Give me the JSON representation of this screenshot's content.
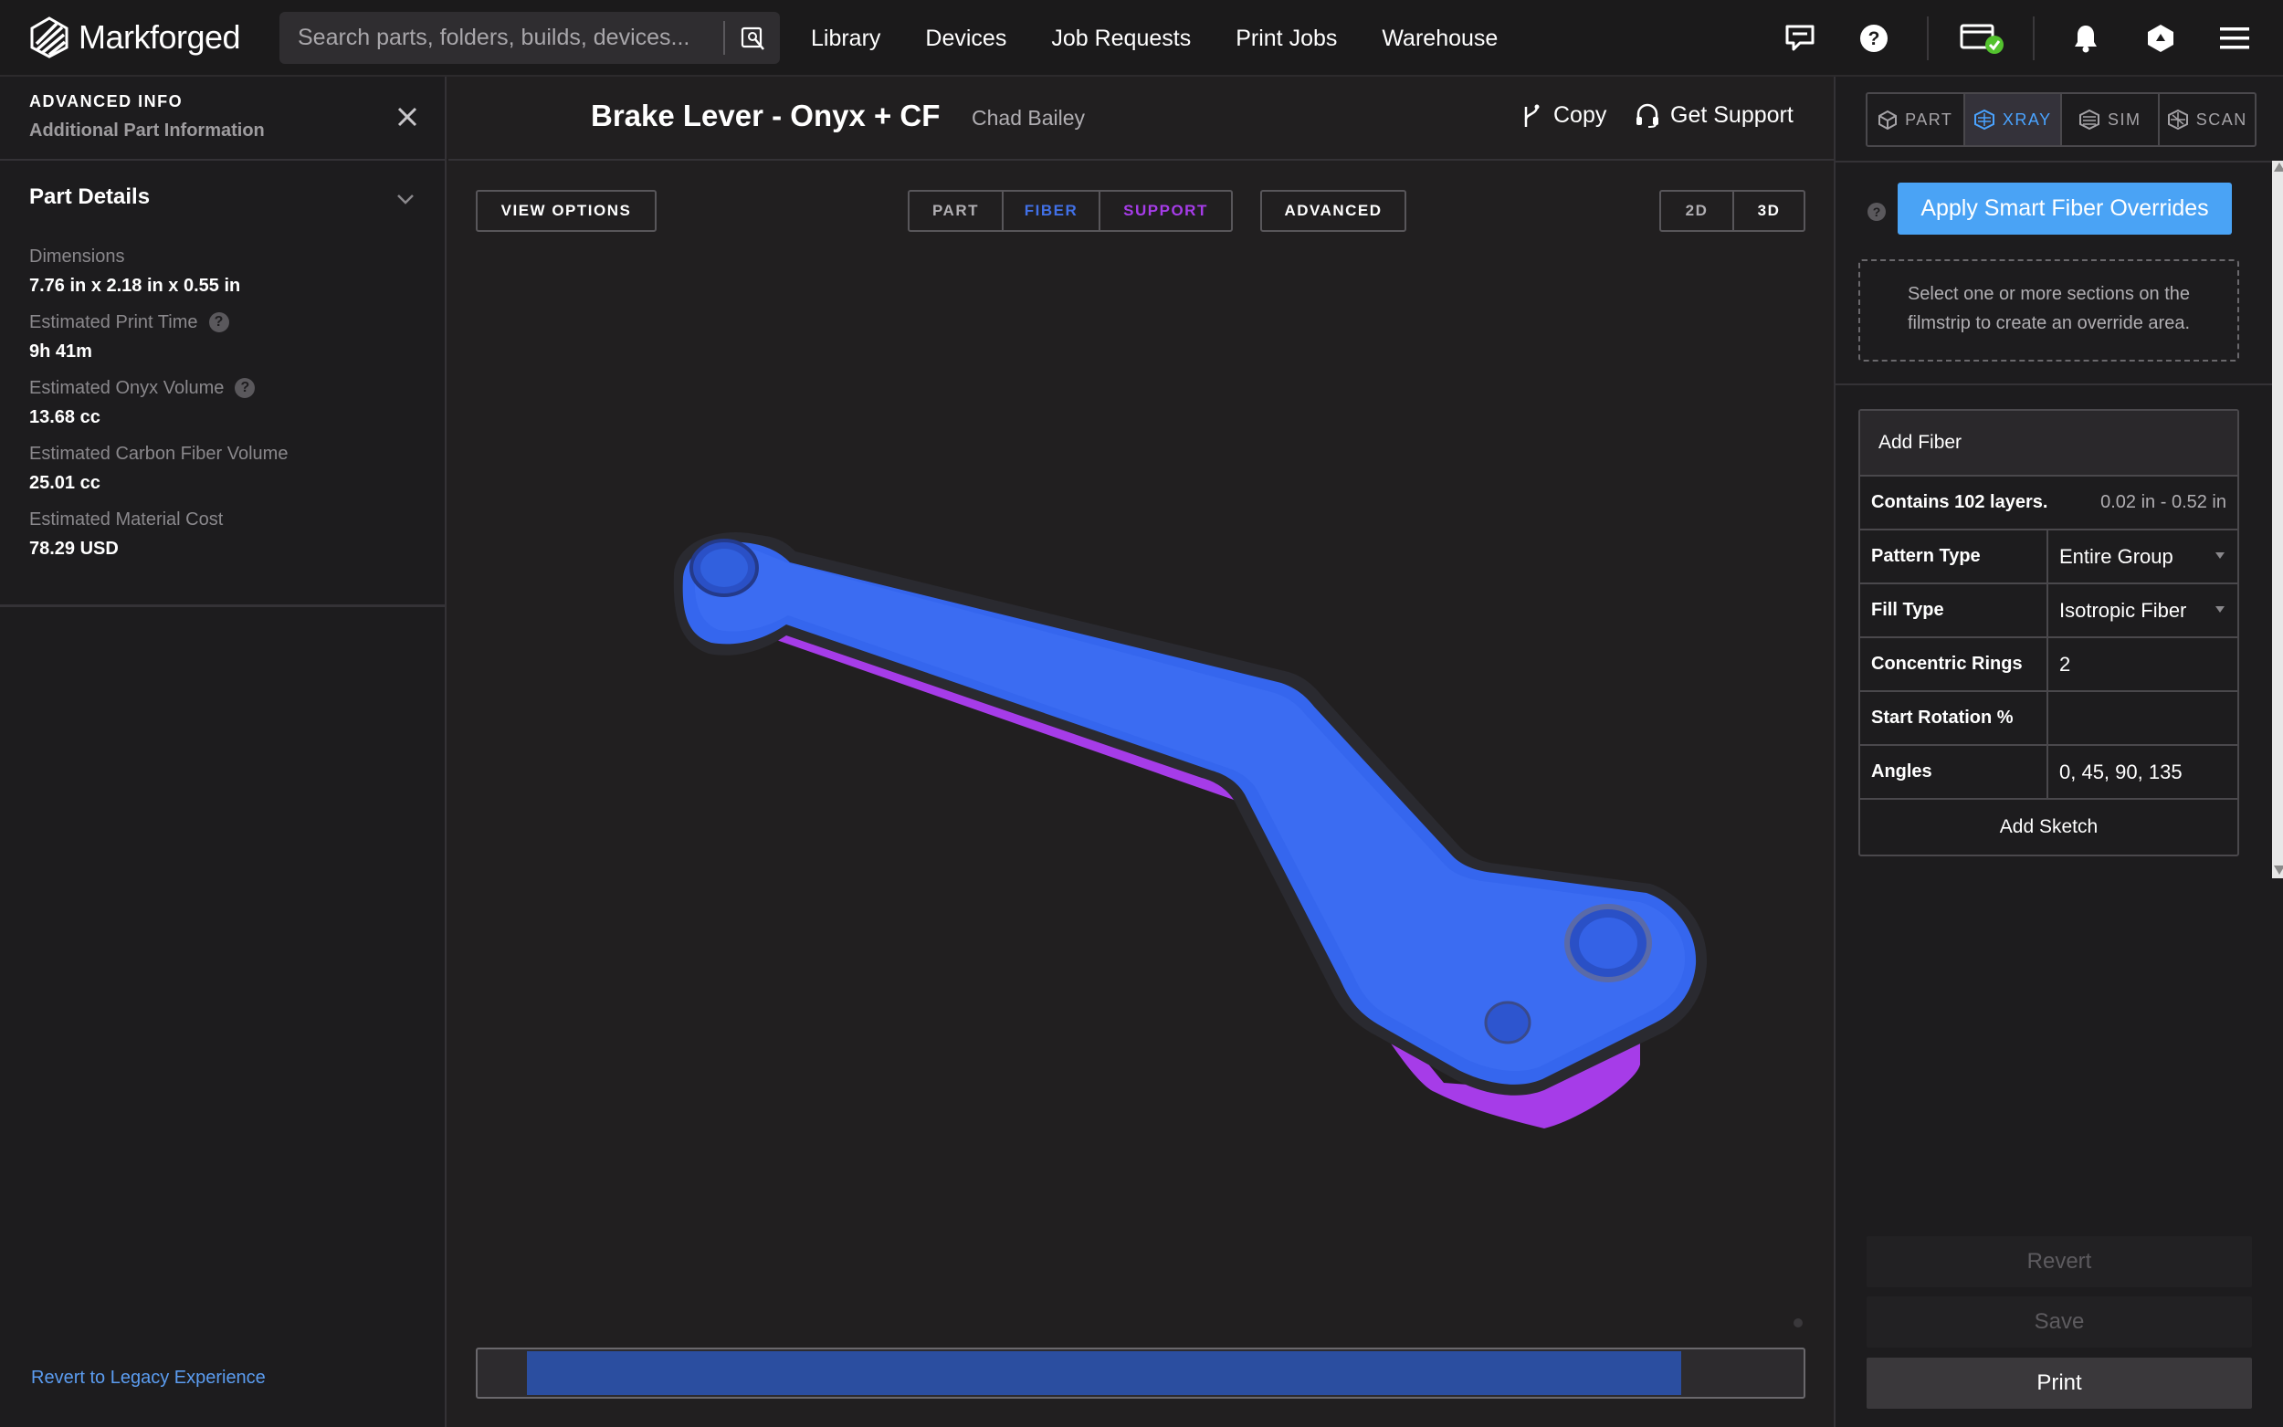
{
  "app": {
    "brand": "Markforged",
    "accent": "#4aa3f5",
    "fiber_color": "#3566ee",
    "support_color": "#a63ce8"
  },
  "search": {
    "placeholder": "Search parts, folders, builds, devices..."
  },
  "nav": {
    "links": [
      "Library",
      "Devices",
      "Job Requests",
      "Print Jobs",
      "Warehouse"
    ]
  },
  "icons": {
    "topbar": [
      "chat-icon",
      "help-icon",
      "license-icon",
      "bell-icon",
      "workspace-icon",
      "menu-icon"
    ]
  },
  "left": {
    "title": "ADVANCED INFO",
    "subtitle": "Additional Part Information",
    "section": "Part Details",
    "details": [
      {
        "label": "Dimensions",
        "value": "7.76 in x 2.18 in x 0.55 in"
      },
      {
        "label": "Estimated Print Time",
        "value": "9h 41m"
      },
      {
        "label": "Estimated Onyx Volume",
        "value": "13.68 cc"
      },
      {
        "label": "Estimated Carbon Fiber Volume",
        "value": "25.01 cc"
      },
      {
        "label": "Estimated Material Cost",
        "value": "78.29 USD"
      }
    ],
    "legacy_link": "Revert to Legacy Experience"
  },
  "header": {
    "part_name": "Brake Lever - Onyx + CF",
    "owner": "Chad Bailey",
    "copy": "Copy",
    "support": "Get Support"
  },
  "viewer": {
    "view_options": "VIEW OPTIONS",
    "layer_toggle": [
      "PART",
      "FIBER",
      "SUPPORT"
    ],
    "advanced": "ADVANCED",
    "dimension_toggle": [
      "2D",
      "3D"
    ],
    "filmstrip_fill_fraction": 0.907
  },
  "right": {
    "tabs": [
      "PART",
      "XRAY",
      "SIM",
      "SCAN"
    ],
    "active_tab": "XRAY",
    "apply_button": "Apply Smart Fiber Overrides",
    "hint": "Select one or more sections on the filmstrip to create an override area.",
    "fiber": {
      "title": "Add Fiber",
      "layers": "Contains 102 layers.",
      "range": "0.02 in - 0.52 in",
      "pattern_label": "Pattern Type",
      "pattern_value": "Entire Group",
      "fill_label": "Fill Type",
      "fill_value": "Isotropic Fiber",
      "rings_label": "Concentric Rings",
      "rings_value": "2",
      "rotation_label": "Start Rotation %",
      "rotation_value": "",
      "angles_label": "Angles",
      "angles_value": "0, 45, 90, 135",
      "add_sketch": "Add Sketch"
    },
    "revert": "Revert",
    "save": "Save",
    "print": "Print"
  }
}
